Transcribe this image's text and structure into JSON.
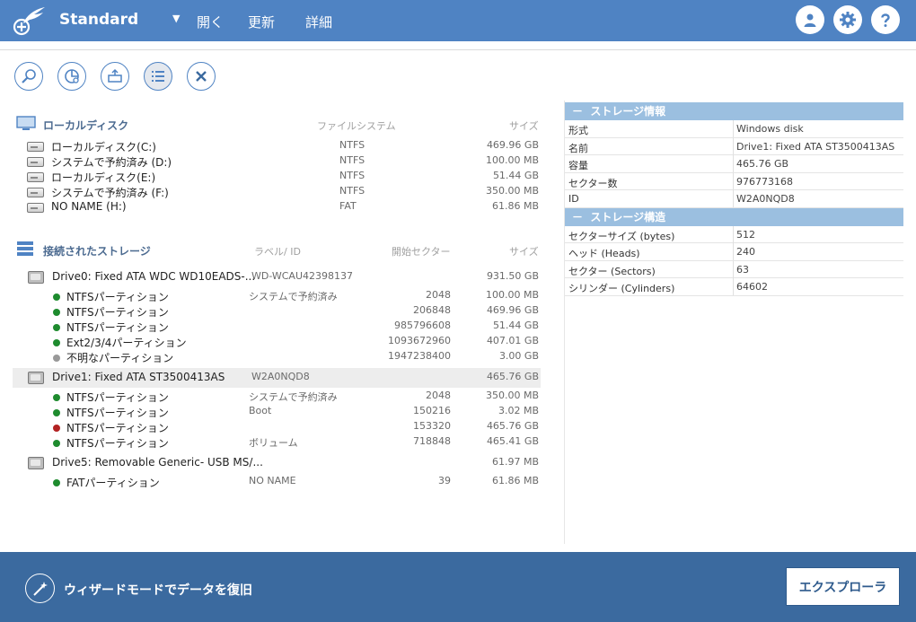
{
  "header": {
    "title": "Standard",
    "dropdown_glyph": "▼",
    "menu": [
      "開く",
      "更新",
      "詳細"
    ],
    "buttons": [
      "user-icon",
      "gear-icon",
      "help-icon"
    ]
  },
  "toolbar": {
    "buttons": [
      "scan-icon",
      "pie-chart-icon",
      "export-icon",
      "list-view-icon",
      "close-icon"
    ]
  },
  "local": {
    "title": "ローカルディスク",
    "col_fs": "ファイルシステム",
    "col_size": "サイズ",
    "rows": [
      {
        "name": "ローカルディスク(C:)",
        "fs": "NTFS",
        "size": "469.96 GB"
      },
      {
        "name": "システムで予約済み (D:)",
        "fs": "NTFS",
        "size": "100.00 MB"
      },
      {
        "name": "ローカルディスク(E:)",
        "fs": "NTFS",
        "size": "51.44 GB"
      },
      {
        "name": "システムで予約済み (F:)",
        "fs": "NTFS",
        "size": "350.00 MB"
      },
      {
        "name": "NO NAME (H:)",
        "fs": "FAT",
        "size": "61.86 MB"
      }
    ]
  },
  "storage": {
    "title": "接続されたストレージ",
    "col_label": "ラベル/ ID",
    "col_sector": "開始セクター",
    "col_size": "サイズ",
    "rows": [
      {
        "kind": "drive",
        "name": "Drive0: Fixed ATA WDC WD10EADS-...",
        "label": "WD-WCAU42398137",
        "sector": "",
        "size": "931.50 GB"
      },
      {
        "kind": "part",
        "dot": "#1e8b2e",
        "name": "NTFSパーティション",
        "label": "システムで予約済み",
        "sector": "2048",
        "size": "100.00 MB"
      },
      {
        "kind": "part",
        "dot": "#1e8b2e",
        "name": "NTFSパーティション",
        "label": "",
        "sector": "206848",
        "size": "469.96 GB"
      },
      {
        "kind": "part",
        "dot": "#1e8b2e",
        "name": "NTFSパーティション",
        "label": "",
        "sector": "985796608",
        "size": "51.44 GB"
      },
      {
        "kind": "part",
        "dot": "#1e8b2e",
        "name": "Ext2/3/4パーティション",
        "label": "",
        "sector": "1093672960",
        "size": "407.01 GB"
      },
      {
        "kind": "part",
        "dot": "#999999",
        "name": "不明なパーティション",
        "label": "",
        "sector": "1947238400",
        "size": "3.00 GB"
      },
      {
        "kind": "drive",
        "selected": true,
        "name": "Drive1: Fixed ATA ST3500413AS",
        "label": "W2A0NQD8",
        "sector": "",
        "size": "465.76 GB"
      },
      {
        "kind": "part",
        "dot": "#1e8b2e",
        "name": "NTFSパーティション",
        "label": "システムで予約済み",
        "sector": "2048",
        "size": "350.00 MB"
      },
      {
        "kind": "part",
        "dot": "#1e8b2e",
        "name": "NTFSパーティション",
        "label": "Boot",
        "sector": "150216",
        "size": "3.02 MB"
      },
      {
        "kind": "part",
        "dot": "#b22222",
        "name": "NTFSパーティション",
        "label": "",
        "sector": "153320",
        "size": "465.76 GB"
      },
      {
        "kind": "part",
        "dot": "#1e8b2e",
        "name": "NTFSパーティション",
        "label": "ボリューム",
        "sector": "718848",
        "size": "465.41 GB"
      },
      {
        "kind": "drive",
        "name": "Drive5: Removable Generic- USB MS/...",
        "label": "",
        "sector": "",
        "size": "61.97 MB"
      },
      {
        "kind": "part",
        "dot": "#1e8b2e",
        "name": "FATパーティション",
        "label": "NO NAME",
        "sector": "39",
        "size": "61.86 MB"
      }
    ]
  },
  "info": {
    "title": "ストレージ情報",
    "rows": [
      {
        "k": "形式",
        "v": "Windows disk"
      },
      {
        "k": "名前",
        "v": "Drive1: Fixed ATA ST3500413AS"
      },
      {
        "k": "容量",
        "v": "465.76 GB"
      },
      {
        "k": "セクター数",
        "v": "976773168"
      },
      {
        "k": "ID",
        "v": "W2A0NQD8"
      }
    ]
  },
  "structure": {
    "title": "ストレージ構造",
    "rows": [
      {
        "k": "セクターサイズ (bytes)",
        "v": "512"
      },
      {
        "k": "ヘッド (Heads)",
        "v": "240"
      },
      {
        "k": "セクター (Sectors)",
        "v": "63"
      },
      {
        "k": "シリンダー (Cylinders)",
        "v": "64602"
      }
    ]
  },
  "collapse_glyph": "－",
  "footer": {
    "wizard_label": "ウィザードモードでデータを復旧",
    "explorer_label": "エクスプローラ"
  },
  "colors": {
    "accent": "#4f83c3",
    "footer": "#3b6a9f",
    "panel_head": "#9bbfe0"
  }
}
